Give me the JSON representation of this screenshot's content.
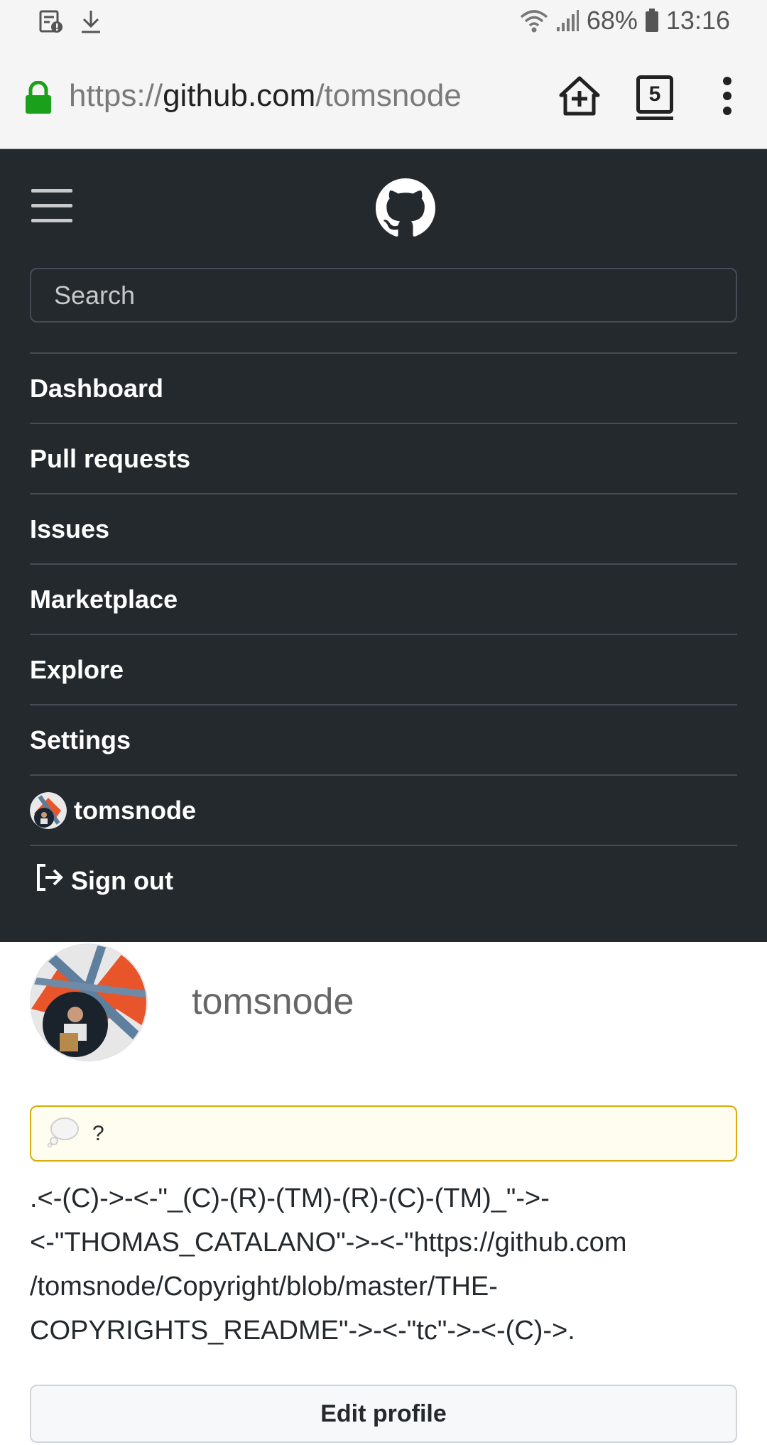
{
  "statusbar": {
    "battery": "68%",
    "time": "13:16",
    "icons": [
      "notification-icon",
      "download-icon",
      "wifi-icon",
      "signal-icon",
      "battery-icon"
    ]
  },
  "browser": {
    "url_scheme": "https://",
    "url_host": "github.com",
    "url_path": "/tomsnode",
    "tab_count": "5"
  },
  "header": {
    "search_placeholder": "Search"
  },
  "nav": {
    "items": [
      {
        "label": "Dashboard"
      },
      {
        "label": "Pull requests"
      },
      {
        "label": "Issues"
      },
      {
        "label": "Marketplace"
      },
      {
        "label": "Explore"
      },
      {
        "label": "Settings"
      }
    ],
    "user_label": "tomsnode",
    "signout_label": "Sign out"
  },
  "profile": {
    "username": "tomsnode",
    "status_text": "?",
    "bio": ".<-(C)->-<-\"_(C)-(R)-(TM)-(R)-(C)-(TM)_\"->-\n<-\"THOMAS_CATALANO\"->-<-\"https://github.com\n/tomsnode/Copyright/blob/master/THE-\nCOPYRIGHTS_README\"->-<-\"tc\"->-<-(C)->.",
    "edit_button": "Edit profile"
  },
  "colors": {
    "header_bg": "#24292e",
    "lock_green": "#1aa01a",
    "status_border": "#dbab09"
  }
}
